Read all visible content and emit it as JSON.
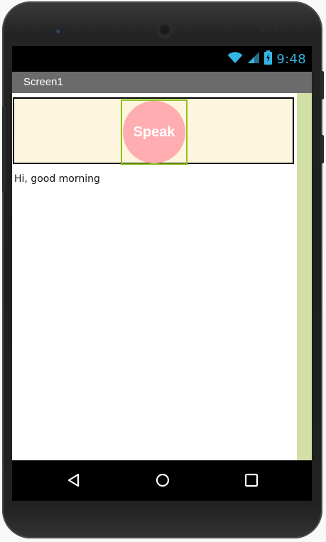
{
  "status_bar": {
    "time": "9:48",
    "icons": [
      "wifi-icon",
      "cellular-signal-icon",
      "battery-charging-icon"
    ],
    "accent_color": "#33b5e5"
  },
  "app": {
    "title": "Screen1",
    "title_bar_color": "#6b6b6b"
  },
  "arrangement": {
    "background_color": "#fdf5dd",
    "speak_button": {
      "label": "Speak",
      "color": "#ffadb0",
      "border_color": "#8ec31a"
    }
  },
  "message_label": {
    "text": "Hi, good morning"
  },
  "side_panel": {
    "color": "#d2e0a6"
  },
  "navigation_bar": {
    "icons": [
      "back-icon",
      "home-icon",
      "recent-apps-icon"
    ]
  }
}
